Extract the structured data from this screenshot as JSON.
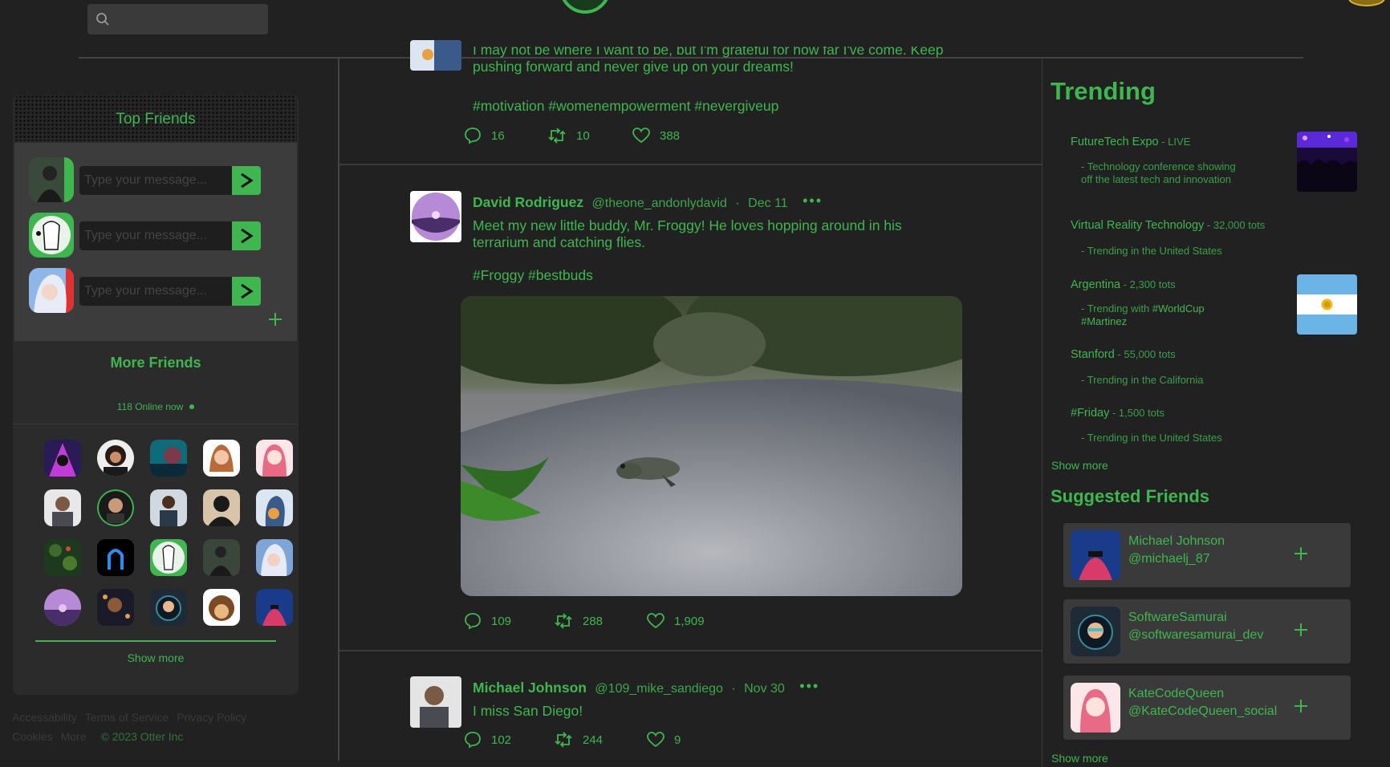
{
  "header": {
    "search_placeholder": "",
    "logo_icon": "otter-logo-icon",
    "coin_icon": "coins-icon"
  },
  "top_friends": {
    "title": "Top Friends",
    "input_placeholder": "Type your message...",
    "rows": [
      {
        "avatar": "hooded-figure-avatar"
      },
      {
        "avatar": "cartoon-woman-avatar"
      },
      {
        "avatar": "anime-girl-avatar"
      }
    ]
  },
  "more_friends": {
    "title": "More Friends",
    "online": "118 Online now",
    "show_more": "Show more"
  },
  "footer": {
    "links": [
      "Accessability",
      "Terms of Service",
      "Privacy Policy",
      "Cookies",
      "More"
    ],
    "copyright": "© 2023 Otter Inc"
  },
  "posts": [
    {
      "text": "I may not be where I want to be, but I'm grateful for how far I've come. Keep pushing forward and never give up on your dreams!",
      "hashtags": "#motivation #womenempowerment #nevergiveup",
      "comments": "16",
      "retweets": "10",
      "likes": "388"
    },
    {
      "author": "David Rodriguez",
      "handle": "@theone_andonlydavid",
      "date": "Dec 11",
      "text": "Meet my new little buddy, Mr. Froggy! He loves hopping around in his terrarium and catching flies.",
      "hashtags": "#Froggy #bestbuds",
      "comments": "109",
      "retweets": "288",
      "likes": "1,909",
      "image": "frog-on-road-photo"
    },
    {
      "author": "Michael Johnson",
      "handle": "@109_mike_sandiego",
      "date": "Nov 30",
      "text": "I miss San Diego!",
      "comments": "102",
      "retweets": "244",
      "likes": "9"
    }
  ],
  "trending": {
    "title": "Trending",
    "items": [
      {
        "name": "FutureTech Expo",
        "count": " - LIVE",
        "desc": "- Technology conference showing off the latest tech and innovation"
      },
      {
        "name": "Virtual Reality Technology",
        "count": " - 32,000 tots",
        "desc": "- Trending in the United States"
      },
      {
        "name": "Argentina",
        "count": " - 2,300 tots",
        "desc_prefix": "- Trending with ",
        "desc_tags": "#WorldCup #Martinez"
      },
      {
        "name": "Stanford",
        "count": " - 55,000 tots",
        "desc": "- Trending in the California"
      },
      {
        "name": "#Friday",
        "count": " - 1,500 tots",
        "desc": "- Trending in the United States"
      }
    ],
    "show_more": "Show more"
  },
  "suggested": {
    "title": "Suggested Friends",
    "items": [
      {
        "name": "Michael Johnson",
        "handle": "@michaelj_87"
      },
      {
        "name": "SoftwareSamurai",
        "handle": "@softwaresamurai_dev"
      },
      {
        "name": "KateCodeQueen",
        "handle": "@KateCodeQueen_social"
      }
    ],
    "show_more": "Show more"
  },
  "colors": {
    "accent": "#3fb650",
    "background": "#212121",
    "panel": "#2b2b2b"
  }
}
